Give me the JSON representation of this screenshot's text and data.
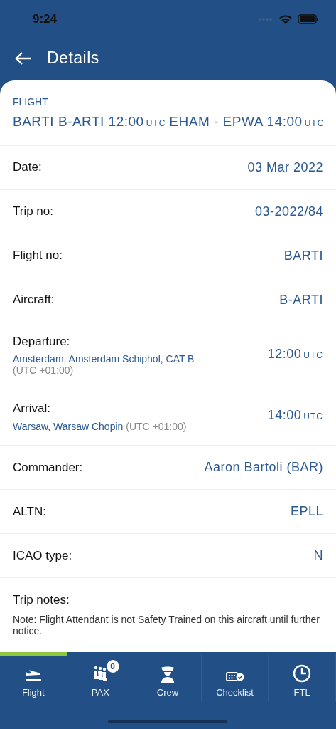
{
  "status_bar": {
    "time": "9:24"
  },
  "header": {
    "title": "Details"
  },
  "flight": {
    "caption": "FLIGHT",
    "title": [
      {
        "text": "BARTI B-ARTI 12:00",
        "kind": "main"
      },
      {
        "text": "UTC",
        "kind": "unit"
      },
      {
        "text": "EHAM - EPWA 14:00",
        "kind": "main"
      },
      {
        "text": "UTC",
        "kind": "unit"
      }
    ]
  },
  "rows": [
    {
      "kind": "simple",
      "label": "Date:",
      "value": "03 Mar 2022"
    },
    {
      "kind": "simple",
      "label": "Trip no:",
      "value": "03-2022/84"
    },
    {
      "kind": "simple",
      "label": "Flight no:",
      "value": "BARTI"
    },
    {
      "kind": "simple",
      "label": "Aircraft:",
      "value": "B-ARTI"
    },
    {
      "kind": "airport",
      "label": "Departure:",
      "place": "Amsterdam, Amsterdam Schiphol, CAT B",
      "tz": "(UTC +01:00)",
      "time": "12:00",
      "unit": "UTC"
    },
    {
      "kind": "airport",
      "label": "Arrival:",
      "place": "Warsaw, Warsaw Chopin",
      "tz": "(UTC +01:00)",
      "time": "14:00",
      "unit": "UTC"
    },
    {
      "kind": "simple",
      "label": "Commander:",
      "value": "Aaron Bartoli (BAR)"
    },
    {
      "kind": "simple",
      "label": "ALTN:",
      "value": "EPLL"
    },
    {
      "kind": "simple",
      "label": "ICAO type:",
      "value": "N"
    },
    {
      "kind": "notes",
      "label": "Trip notes:",
      "text": "Note: Flight Attendant is not Safety Trained on this aircraft until further notice."
    }
  ],
  "tabs": [
    {
      "label": "Flight",
      "selected": true
    },
    {
      "label": "PAX",
      "selected": false,
      "badge": "0"
    },
    {
      "label": "Crew",
      "selected": false
    },
    {
      "label": "Checklist",
      "selected": false
    },
    {
      "label": "FTL",
      "selected": false
    }
  ]
}
